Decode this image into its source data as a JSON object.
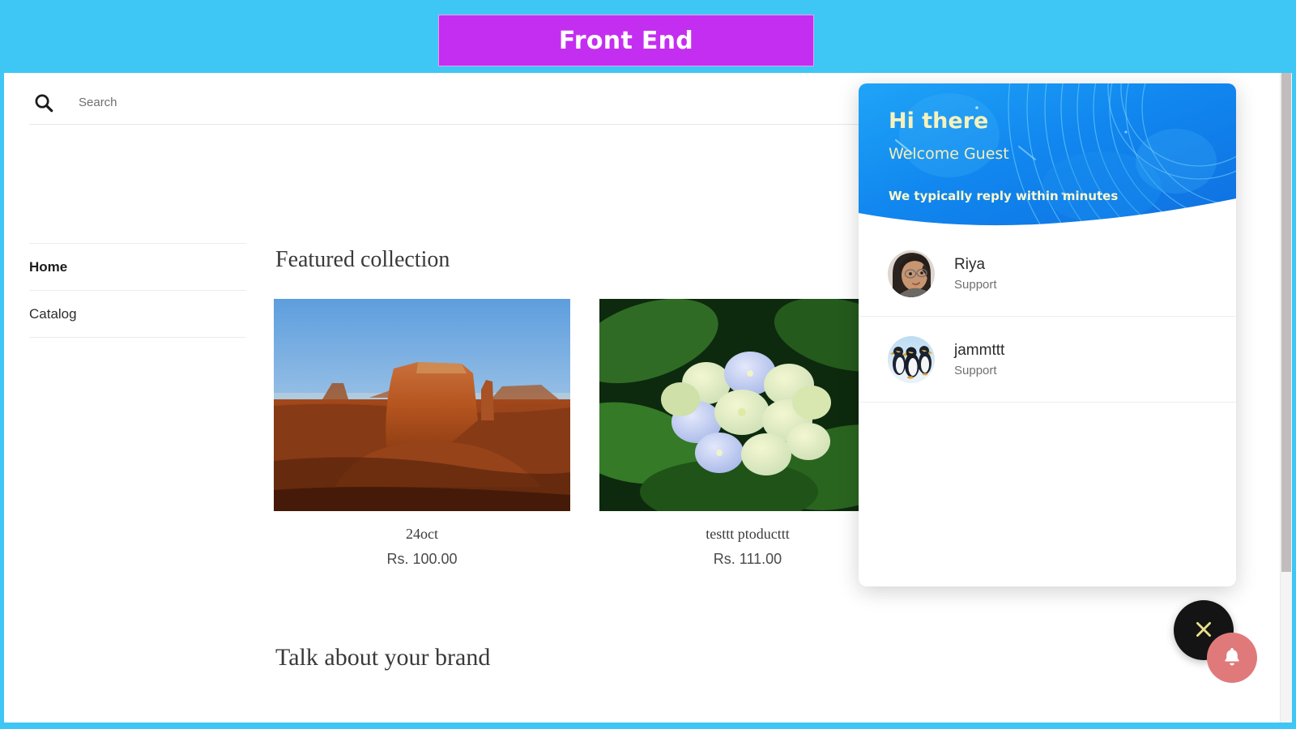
{
  "banner": {
    "label": "Front End",
    "chip_color": "#c42ef0",
    "bar_color": "#3ec6f5"
  },
  "search": {
    "icon": "search-icon",
    "placeholder": "Search",
    "value": ""
  },
  "sidebar": {
    "items": [
      {
        "label": "Home",
        "active": true
      },
      {
        "label": "Catalog",
        "active": false
      }
    ]
  },
  "main": {
    "featured_title": "Featured collection",
    "brand_title": "Talk about your brand",
    "products": [
      {
        "name": "24oct",
        "price": "Rs. 100.00",
        "image": "desert-butte-photo"
      },
      {
        "name": "testtt ptoducttt",
        "price": "Rs. 111.00",
        "image": "hydrangea-flowers-photo"
      }
    ]
  },
  "chat": {
    "greeting": "Hi there",
    "welcome": "Welcome Guest",
    "reply_time": "We typically reply within minutes",
    "header_color": "#0c8ff0",
    "agents": [
      {
        "name": "Riya",
        "role": "Support",
        "avatar": "woman-portrait-avatar"
      },
      {
        "name": "jammttt",
        "role": "Support",
        "avatar": "penguins-avatar"
      }
    ]
  },
  "fab": {
    "close_icon": "close-icon",
    "bell_icon": "bell-icon",
    "close_color": "#141414",
    "bell_color": "#e07a7a"
  }
}
